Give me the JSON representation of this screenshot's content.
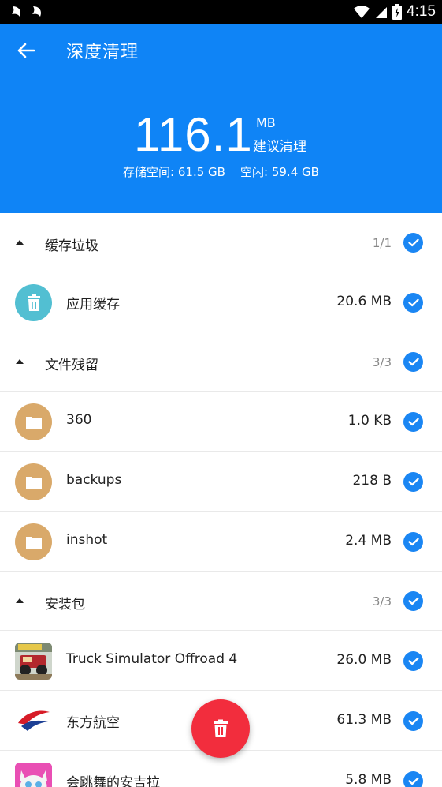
{
  "status_bar": {
    "time": "4:15"
  },
  "header": {
    "title": "深度清理",
    "total_size": "116.1",
    "total_unit": "MB",
    "hint": "建议清理",
    "storage_text": "存储空间: 61.5 GB    空闲: 59.4 GB"
  },
  "sections": [
    {
      "label": "缓存垃圾",
      "count": "1/1",
      "items": [
        {
          "label": "应用缓存",
          "size": "20.6 MB",
          "icon": "trash-icon"
        }
      ]
    },
    {
      "label": "文件残留",
      "count": "3/3",
      "items": [
        {
          "label": "360",
          "size": "1.0 KB",
          "icon": "folder-icon"
        },
        {
          "label": "backups",
          "size": "218 B",
          "icon": "folder-icon"
        },
        {
          "label": "inshot",
          "size": "2.4 MB",
          "icon": "folder-icon"
        }
      ]
    },
    {
      "label": "安装包",
      "count": "3/3",
      "items": [
        {
          "label": "Truck Simulator Offroad 4",
          "size": "26.0 MB",
          "icon": "truck-app-icon"
        },
        {
          "label": "东方航空",
          "size": "61.3 MB",
          "icon": "china-eastern-app-icon"
        },
        {
          "label": "会跳舞的安吉拉",
          "size": "5.8 MB",
          "icon": "angela-app-icon"
        }
      ]
    }
  ],
  "colors": {
    "header_bg": "#0f84f6",
    "check": "#1a86f3",
    "fab": "#f22d3d",
    "trash_circle": "#52bfd2",
    "folder_circle": "#d9a96a"
  }
}
